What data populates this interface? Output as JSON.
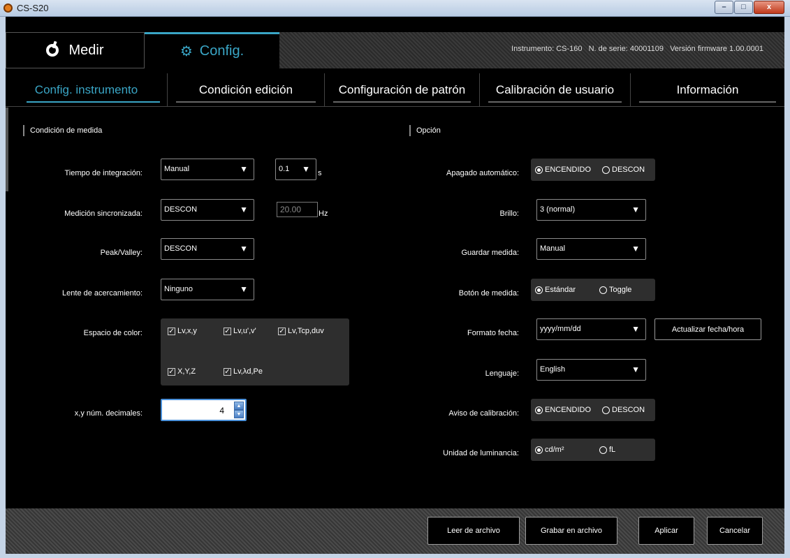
{
  "window": {
    "title": "CS-S20",
    "btn_min": "–",
    "btn_max": "□",
    "btn_close": "x"
  },
  "topbar": {
    "measure_label": "Medir",
    "config_label": "Config.",
    "instrument": "Instrumento:  CS-160",
    "serial": "N. de serie:  40001109",
    "firmware": "Versión firmware  1.00.0001"
  },
  "subtabs": [
    "Config. instrumento",
    "Condición edición",
    "Configuración de patrón",
    "Calibración de usuario",
    "Información"
  ],
  "left": {
    "header": "Condición de medida",
    "integration_label": "Tiempo de integración:",
    "integration_value": "Manual",
    "integration_time": "0.1",
    "integration_unit": "s",
    "sync_label": "Medición sincronizada:",
    "sync_value": "DESCON",
    "sync_freq": "20.00",
    "sync_unit": "Hz",
    "peak_label": "Peak/Valley:",
    "peak_value": "DESCON",
    "lens_label": "Lente de acercamiento:",
    "lens_value": "Ninguno",
    "colorspace_label": "Espacio de color:",
    "colorspaces": [
      "Lv,x,y",
      "Lv,u',v'",
      "Lv,Tcp,duv",
      "X,Y,Z",
      "Lv,λd,Pe"
    ],
    "decimals_label": "x,y núm. decimales:",
    "decimals_value": "4"
  },
  "right": {
    "header": "Opción",
    "autooff_label": "Apagado automático:",
    "on_label": "ENCENDIDO",
    "off_label": "DESCON",
    "brightness_label": "Brillo:",
    "brightness_value": "3 (normal)",
    "save_label": "Guardar medida:",
    "save_value": "Manual",
    "button_label": "Botón de medida:",
    "button_standard": "Estándar",
    "button_toggle": "Toggle",
    "date_label": "Formato fecha:",
    "date_value": "yyyy/mm/dd",
    "update_date": "Actualizar fecha/hora",
    "lang_label": "Lenguaje:",
    "lang_value": "English",
    "calwarn_label": "Aviso de calibración:",
    "unit_label": "Unidad de luminancia:",
    "unit_cd": "cd/m²",
    "unit_fl": "fL"
  },
  "bottom": {
    "read_file": "Leer de archivo",
    "save_file": "Grabar en archivo",
    "apply": "Aplicar",
    "cancel": "Cancelar"
  },
  "colors": {
    "accent": "#3aa6c6"
  }
}
